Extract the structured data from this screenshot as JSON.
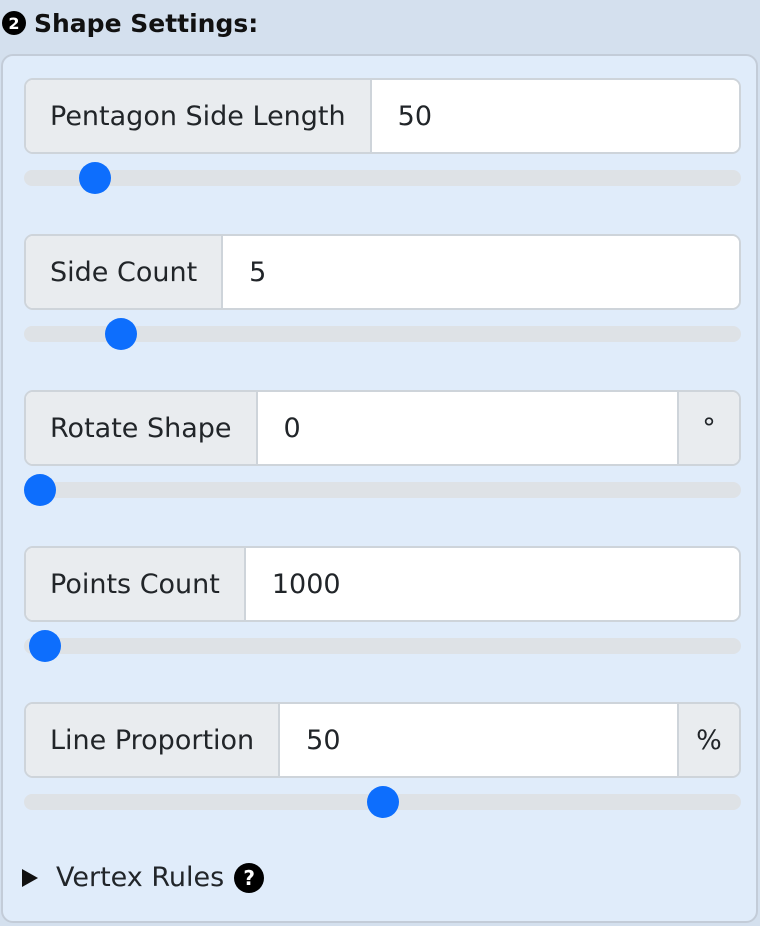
{
  "header": {
    "step": "2",
    "title": "Shape Settings:"
  },
  "fields": [
    {
      "label": "Pentagon Side Length",
      "value": "50",
      "suffix": null,
      "slider_fraction": 0.08
    },
    {
      "label": "Side Count",
      "value": "5",
      "suffix": null,
      "slider_fraction": 0.118
    },
    {
      "label": "Rotate Shape",
      "value": "0",
      "suffix": "°",
      "slider_fraction": 0.0
    },
    {
      "label": "Points Count",
      "value": "1000",
      "suffix": null,
      "slider_fraction": 0.008
    },
    {
      "label": "Line Proportion",
      "value": "50",
      "suffix": "%",
      "slider_fraction": 0.5
    }
  ],
  "details": {
    "label": "Vertex Rules",
    "help_glyph": "?"
  },
  "colors": {
    "accent": "#0d6efd",
    "panel": "#e0ecfa",
    "page": "#d4e0ee"
  }
}
